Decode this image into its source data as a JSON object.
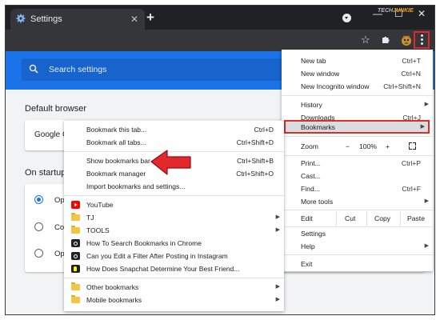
{
  "watermark": {
    "prefix": "TECH",
    "suffix": "JUNKIE"
  },
  "tab": {
    "title": "Settings"
  },
  "window": {
    "minimize": "—",
    "maximize": "☐",
    "close": "✕"
  },
  "toolbar": {
    "star_icon": "star-icon",
    "puzzle_icon": "puzzle-icon",
    "menu_icon": "three-dots-icon"
  },
  "search": {
    "placeholder": "Search settings"
  },
  "settings": {
    "default_browser": "Default browser",
    "default_browser_card": "Google C",
    "on_startup": "On startup",
    "startup_options": [
      "Op",
      "Co",
      "Op"
    ],
    "selected_option": 0
  },
  "main_menu": {
    "new_tab": {
      "label": "New tab",
      "shortcut": "Ctrl+T"
    },
    "new_window": {
      "label": "New window",
      "shortcut": "Ctrl+N"
    },
    "new_incognito": {
      "label": "New Incognito window",
      "shortcut": "Ctrl+Shift+N"
    },
    "history": {
      "label": "History"
    },
    "downloads": {
      "label": "Downloads",
      "shortcut": "Ctrl+J"
    },
    "bookmarks": {
      "label": "Bookmarks"
    },
    "zoom": {
      "label": "Zoom",
      "minus": "−",
      "value": "100%",
      "plus": "+"
    },
    "print": {
      "label": "Print...",
      "shortcut": "Ctrl+P"
    },
    "cast": {
      "label": "Cast..."
    },
    "find": {
      "label": "Find...",
      "shortcut": "Ctrl+F"
    },
    "more_tools": {
      "label": "More tools"
    },
    "edit": {
      "label": "Edit",
      "cut": "Cut",
      "copy": "Copy",
      "paste": "Paste"
    },
    "settings": {
      "label": "Settings"
    },
    "help": {
      "label": "Help"
    },
    "exit": {
      "label": "Exit"
    }
  },
  "bookmarks_menu": {
    "bookmark_tab": {
      "label": "Bookmark this tab...",
      "shortcut": "Ctrl+D"
    },
    "bookmark_all": {
      "label": "Bookmark all tabs...",
      "shortcut": "Ctrl+Shift+D"
    },
    "show_bar": {
      "label": "Show bookmarks bar",
      "shortcut": "Ctrl+Shift+B"
    },
    "manager": {
      "label": "Bookmark manager",
      "shortcut": "Ctrl+Shift+O"
    },
    "import": {
      "label": "Import bookmarks and settings..."
    },
    "items": [
      {
        "label": "YouTube",
        "icon": "youtube-icon"
      },
      {
        "label": "TJ",
        "icon": "folder-icon",
        "submenu": true
      },
      {
        "label": "TOOLS",
        "icon": "folder-icon",
        "submenu": true
      },
      {
        "label": "How To Search Bookmarks in Chrome",
        "icon": "site-icon"
      },
      {
        "label": "Can you Edit a Filter After Posting in Instagram",
        "icon": "site-icon"
      },
      {
        "label": "How Does Snapchat Determine Your Best Friend...",
        "icon": "snapchat-icon"
      }
    ],
    "other": {
      "label": "Other bookmarks"
    },
    "mobile": {
      "label": "Mobile bookmarks"
    }
  },
  "colors": {
    "accent": "#1a73e8",
    "highlight_border": "#d93025",
    "arrow": "#e4262d"
  }
}
